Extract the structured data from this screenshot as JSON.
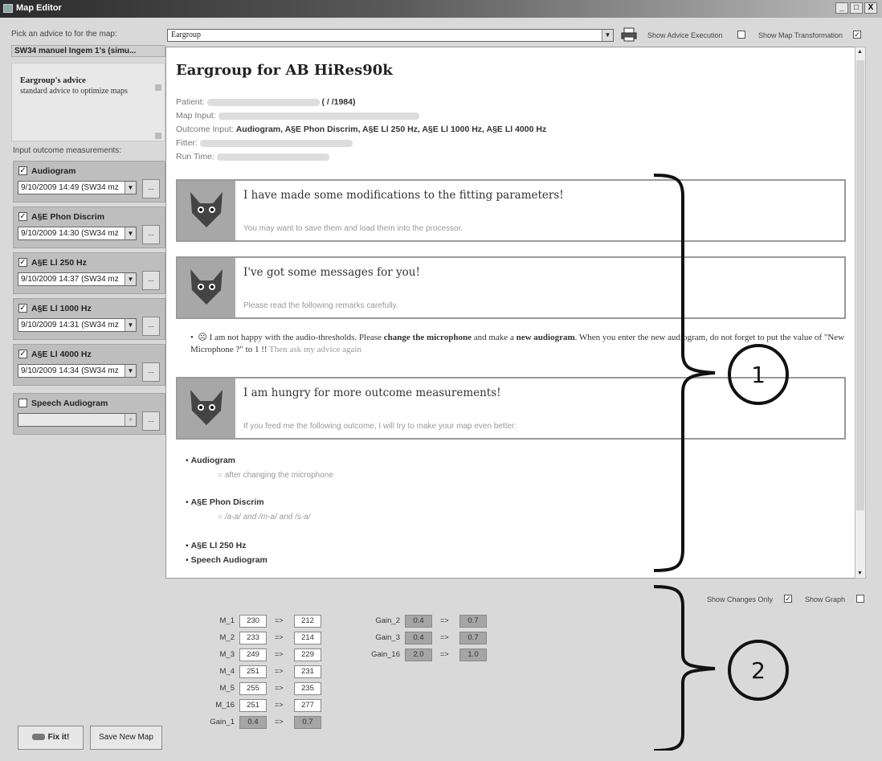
{
  "window": {
    "title": "Map Editor",
    "min": "_",
    "max": "□",
    "close": "X"
  },
  "left": {
    "pick_label": "Pick an advice to for the map:",
    "selected_advice": "SW34 manuel Ingem 1's (simu...",
    "advice_title": "Eargroup's advice",
    "advice_desc": "standard advice to optimize maps",
    "input_label": "Input outcome measurements:",
    "measurements": [
      {
        "name": "Audiogram",
        "checked": true,
        "value": "9/10/2009 14:49 (SW34 mz"
      },
      {
        "name": "A§E Phon Discrim",
        "checked": true,
        "value": "9/10/2009 14:30 (SW34 mz"
      },
      {
        "name": "A§E Ll 250 Hz",
        "checked": true,
        "value": "9/10/2009 14:37 (SW34 mz"
      },
      {
        "name": "A§E Ll 1000 Hz",
        "checked": true,
        "value": "9/10/2009 14:31 (SW34 mz"
      },
      {
        "name": "A§E Ll 4000 Hz",
        "checked": true,
        "value": "9/10/2009 14:34 (SW34 mz"
      },
      {
        "name": "Speech Audiogram",
        "checked": false,
        "value": ""
      }
    ],
    "dots": "...",
    "fixit": "Fix it!",
    "savemap": "Save New Map"
  },
  "topbar": {
    "combo_value": "Eargroup",
    "show_advice_label": "Show Advice Execution",
    "show_advice_checked": false,
    "show_map_label": "Show Map Transformation",
    "show_map_checked": true
  },
  "report": {
    "title": "Eargroup for AB HiRes90k",
    "patient_label": "Patient:",
    "patient_dob": "( /  /1984)",
    "mapinput_label": "Map Input:",
    "outcome_label": "Outcome Input:",
    "outcome_value": "Audiogram, A§E Phon Discrim, A§E Ll 250 Hz, A§E Ll 1000 Hz, A§E Ll 4000 Hz",
    "fitter_label": "Fitter:",
    "runtime_label": "Run Time:",
    "msg1_title": "I have made some modifications to the fitting parameters!",
    "msg1_sub": "You may want to save them and load them into the processor.",
    "msg2_title": "I've got some messages for you!",
    "msg2_sub": "Please read the following remarks carefully.",
    "para_a": "☹ I am not happy with the audio-thresholds.  Please ",
    "para_b": "change the microphone",
    "para_c": " and make a ",
    "para_d": "new audiogram",
    "para_e": ".  When you enter the new audiogram, do not forget to put the value of \"New Microphone ?\" to 1 !!",
    "para_f": "  Then ask my advice again",
    "msg3_title": "I am hungry for more outcome measurements!",
    "msg3_sub": "If you feed me the following outcome, I will try to make your map even better:",
    "list1": "Audiogram",
    "list1_sub": "after changing the microphone",
    "list2": "A§E Phon Discrim",
    "list2_sub": "/a-a/ and /m-a/ and /s-a/",
    "list3": "A§E Ll 250 Hz",
    "list4": "Speech Audiogram"
  },
  "bottom": {
    "show_changes_label": "Show Changes Only",
    "show_changes_checked": true,
    "show_graph_label": "Show Graph",
    "show_graph_checked": false,
    "arrow": "=>",
    "left_params": [
      {
        "name": "M_1",
        "from": "230",
        "to": "212"
      },
      {
        "name": "M_2",
        "from": "233",
        "to": "214"
      },
      {
        "name": "M_3",
        "from": "249",
        "to": "229"
      },
      {
        "name": "M_4",
        "from": "251",
        "to": "231"
      },
      {
        "name": "M_5",
        "from": "255",
        "to": "235"
      },
      {
        "name": "M_16",
        "from": "251",
        "to": "277"
      },
      {
        "name": "Gain_1",
        "from": "0.4",
        "to": "0.7"
      }
    ],
    "right_params": [
      {
        "name": "Gain_2",
        "from": "0.4",
        "to": "0.7"
      },
      {
        "name": "Gain_3",
        "from": "0.4",
        "to": "0.7"
      },
      {
        "name": "Gain_16",
        "from": "2.0",
        "to": "1.0"
      }
    ]
  },
  "annotations": {
    "one": "1",
    "two": "2"
  }
}
